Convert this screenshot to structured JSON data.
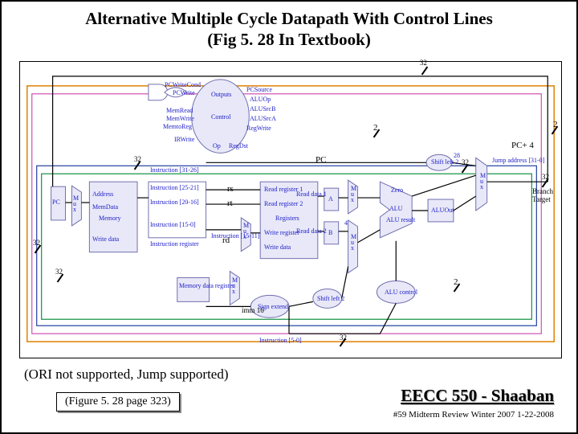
{
  "title_line1": "Alternative Multiple Cycle Datapath With Control Lines",
  "title_line2": "(Fig 5. 28 In Textbook)",
  "labels": {
    "bw32_top": "32",
    "bw2_mid": "2",
    "bw2_right": "2",
    "pc4": "PC+ 4",
    "bw32_left": "32",
    "pc": "PC",
    "bw32_midright": "32",
    "bw32_farright": "32",
    "rs": "rs",
    "rt": "rt",
    "rd": "rd",
    "branch": "Branch\nTarget",
    "bw32_leftlow": "32",
    "bw32_midlow": "32",
    "bw2_low": "2",
    "imm16": "imm 16",
    "bw32_bottom": "32"
  },
  "control": {
    "pcwritecond": "PCWriteCond",
    "pcwrite": "PCWrite",
    "outputs": "Outputs",
    "memread": "MemRead",
    "memwrite": "MemWrite",
    "control": "Control",
    "memtoreg": "MemtoReg",
    "irwrite": "IRWrite",
    "op": "Op",
    "pcsource": "PCSource",
    "aluop": "ALUOp",
    "alusrcb": "ALUSrcB",
    "alusrca": "ALUSrcA",
    "regwrite": "RegWrite",
    "regdst": "RegDst",
    "alucontrol": "ALU control",
    "jump": "Jump address [31-0]"
  },
  "blocks": {
    "pc": "PC",
    "memory": "Memory",
    "address": "Address",
    "memdata": "MemData",
    "writedata": "Write data",
    "instreg": "Instruction register",
    "mdr": "Memory data register",
    "reg": "Registers",
    "readreg1": "Read register 1",
    "readreg2": "Read register 2",
    "writereg": "Write register",
    "writedata2": "Write data",
    "readdata1": "Read data 1",
    "readdata2": "Read data 2",
    "a": "A",
    "b": "B",
    "alu": "ALU",
    "aluout": "ALUOut",
    "signext": "Sign extend",
    "shl2": "Shift left 2",
    "mux": "M\nu\nx",
    "inst2521": "Instruction [25-21]",
    "inst2016": "Instruction [20-16]",
    "inst150": "Instruction [15-0]",
    "inst1511": "Instruction [15-11]",
    "inst50": "Instruction [5-0]",
    "inst2526": "Instruction [31-26]",
    "zero": "Zero",
    "aluresult": "ALU result",
    "four": "4",
    "shl2b": "Shift left 2",
    "two28": "28"
  },
  "note": "(ORI not supported, Jump supported)",
  "figref": "(Figure 5. 28 page 323)",
  "course": "EECC 550 - Shaaban",
  "meta": "#59   Midterm Review   Winter 2007  1-22-2008"
}
